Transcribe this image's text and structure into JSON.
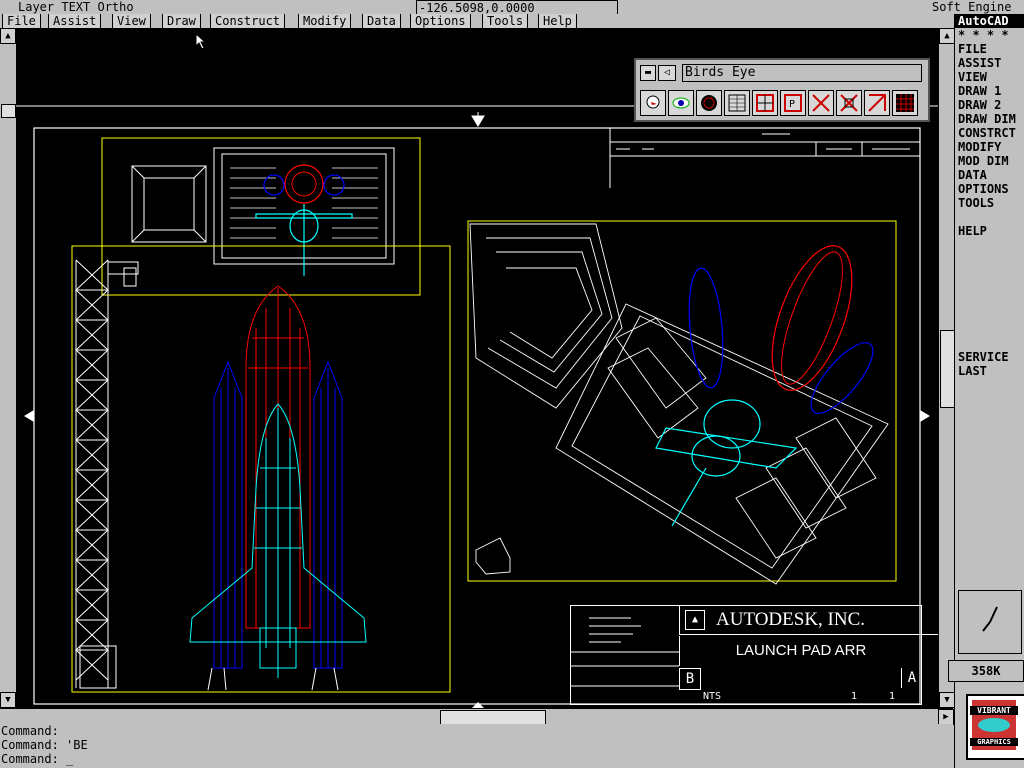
{
  "status": {
    "layer_text": "Layer TEXT Ortho",
    "coords": "-126.5098,0.0000",
    "app": "Soft Engine"
  },
  "menu": [
    "File",
    "Assist",
    "View",
    "Draw",
    "Construct",
    "Modify",
    "Data",
    "Options",
    "Tools",
    "Help"
  ],
  "side_menu": {
    "title": "AutoCAD",
    "stars": "* * * *",
    "items": [
      "FILE",
      "ASSIST",
      "VIEW",
      "DRAW 1",
      "DRAW 2",
      "DRAW DIM",
      "CONSTRCT",
      "MODIFY",
      "MOD DIM",
      "DATA",
      "OPTIONS",
      "TOOLS"
    ],
    "help": "HELP",
    "bottom": [
      "SERVICE",
      "LAST"
    ]
  },
  "toolbar": {
    "title": "Birds Eye",
    "icons": [
      "eagle-icon",
      "eye-icon",
      "globe-icon",
      "grid-icon",
      "window-icon",
      "pan-icon",
      "zoom-in-icon",
      "zoom-out-icon",
      "zoom-icon",
      "keypad-icon"
    ]
  },
  "title_block": {
    "company": "AUTODESK, INC.",
    "drawing": "LAUNCH PAD ARR",
    "size": "B",
    "rev": "A",
    "scale": "NTS",
    "sheet_a": "1",
    "sheet_b": "1"
  },
  "memory": "358K",
  "logo": {
    "line1": "VIBRANT",
    "line2": "GRAPHICS"
  },
  "command_lines": [
    "Command:",
    "Command: 'BE",
    "Command: _"
  ]
}
